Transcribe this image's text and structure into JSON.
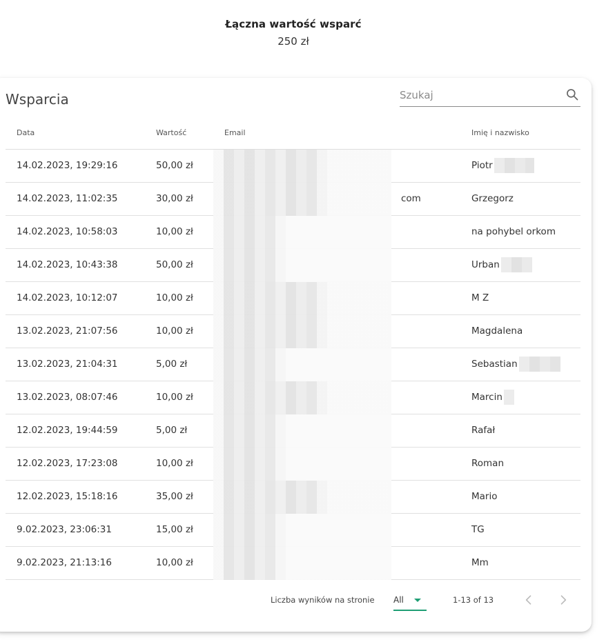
{
  "summary": {
    "title": "Łączna wartość wsparć",
    "value": "250 zł"
  },
  "table": {
    "title": "Wsparcia",
    "search_placeholder": "Szukaj",
    "columns": [
      "Data",
      "Wartość",
      "Email",
      "Imię i nazwisko"
    ],
    "rows": [
      {
        "date": "14.02.2023, 19:29:16",
        "value": "50,00 zł",
        "email": "",
        "name": "Piotr"
      },
      {
        "date": "14.02.2023, 11:02:35",
        "value": "30,00 zł",
        "email": "com",
        "name": "Grzegorz"
      },
      {
        "date": "14.02.2023, 10:58:03",
        "value": "10,00 zł",
        "email": "",
        "name": "na pohybel orkom"
      },
      {
        "date": "14.02.2023, 10:43:38",
        "value": "50,00 zł",
        "email": "",
        "name": "Urban"
      },
      {
        "date": "14.02.2023, 10:12:07",
        "value": "10,00 zł",
        "email": "",
        "name": "M Z"
      },
      {
        "date": "13.02.2023, 21:07:56",
        "value": "10,00 zł",
        "email": "",
        "name": "Magdalena"
      },
      {
        "date": "13.02.2023, 21:04:31",
        "value": "5,00 zł",
        "email": "",
        "name": "Sebastian"
      },
      {
        "date": "13.02.2023, 08:07:46",
        "value": "10,00 zł",
        "email": "",
        "name": "Marcin"
      },
      {
        "date": "12.02.2023, 19:44:59",
        "value": "5,00 zł",
        "email": "",
        "name": "Rafał"
      },
      {
        "date": "12.02.2023, 17:23:08",
        "value": "10,00 zł",
        "email": "",
        "name": "Roman"
      },
      {
        "date": "12.02.2023, 15:18:16",
        "value": "35,00 zł",
        "email": "",
        "name": "Mario"
      },
      {
        "date": "9.02.2023, 23:06:31",
        "value": "15,00 zł",
        "email": "",
        "name": "TG"
      },
      {
        "date": "9.02.2023, 21:13:16",
        "value": "10,00 zł",
        "email": "",
        "name": "Mm"
      }
    ]
  },
  "pagination": {
    "rows_per_page_label": "Liczba wyników na stronie",
    "rows_per_page_value": "All",
    "range_text": "1-13 of 13"
  },
  "colors": {
    "accent": "#1e9e74"
  },
  "icons": {
    "search": "search-icon",
    "prev": "chevron-left-icon",
    "next": "chevron-right-icon",
    "dropdown": "caret-down-icon"
  }
}
